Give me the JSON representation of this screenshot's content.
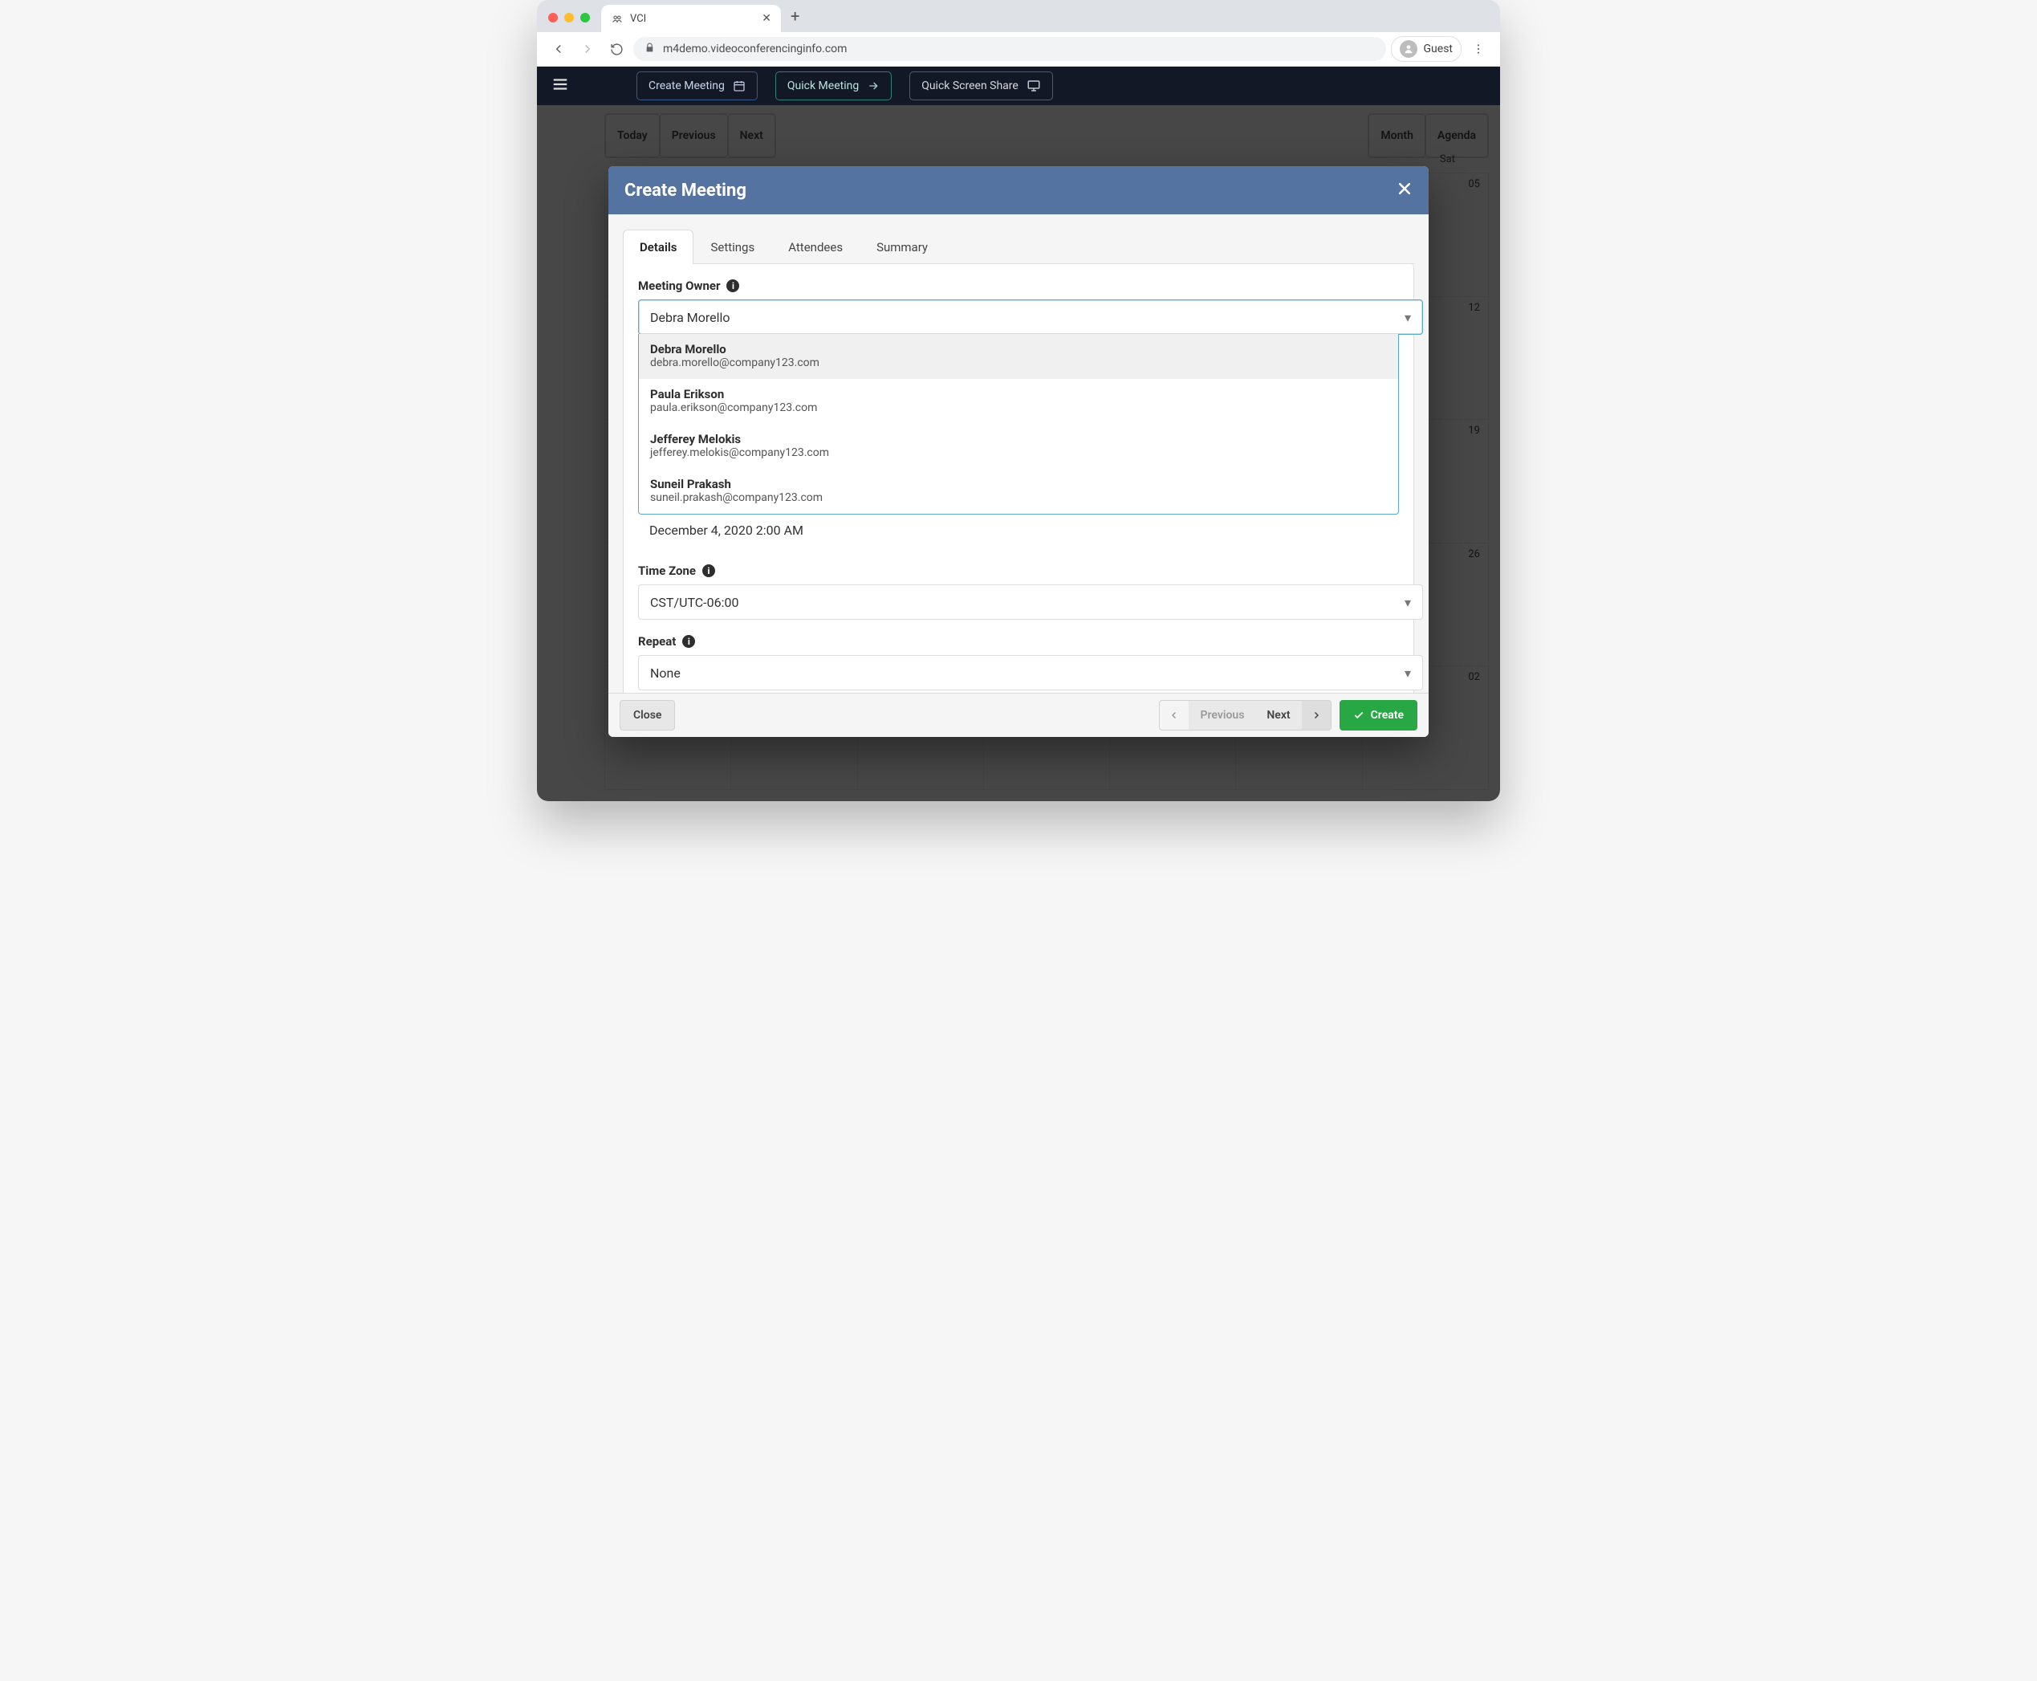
{
  "browser": {
    "tab_title": "VCI",
    "url": "m4demo.videoconferencinginfo.com",
    "guest_label": "Guest"
  },
  "appbar": {
    "create_meeting": "Create Meeting",
    "quick_meeting": "Quick Meeting",
    "quick_share": "Quick Screen Share"
  },
  "calendar": {
    "left_btns": {
      "today": "Today",
      "prev": "Previous",
      "next": "Next"
    },
    "center_title": "",
    "views": {
      "month": "Month",
      "agenda": "Agenda"
    },
    "day_header_sat": "Sat",
    "dates_right": [
      "05",
      "12",
      "19",
      "26",
      "02"
    ]
  },
  "modal": {
    "title": "Create Meeting",
    "tabs": {
      "details": "Details",
      "settings": "Settings",
      "attendees": "Attendees",
      "summary": "Summary"
    },
    "owner_label": "Meeting Owner",
    "owner_value": "Debra Morello",
    "owners": [
      {
        "name": "Debra Morello",
        "email": "debra.morello@company123.com"
      },
      {
        "name": "Paula Erikson",
        "email": "paula.erikson@company123.com"
      },
      {
        "name": "Jefferey Melokis",
        "email": "jefferey.melokis@company123.com"
      },
      {
        "name": "Suneil Prakash",
        "email": "suneil.prakash@company123.com"
      }
    ],
    "peek_datetime": "December 4, 2020 2:00 AM",
    "tz_label": "Time Zone",
    "tz_value": "CST/UTC-06:00",
    "repeat_label": "Repeat",
    "repeat_value": "None",
    "footer": {
      "close": "Close",
      "previous": "Previous",
      "next": "Next",
      "create": "Create"
    }
  }
}
